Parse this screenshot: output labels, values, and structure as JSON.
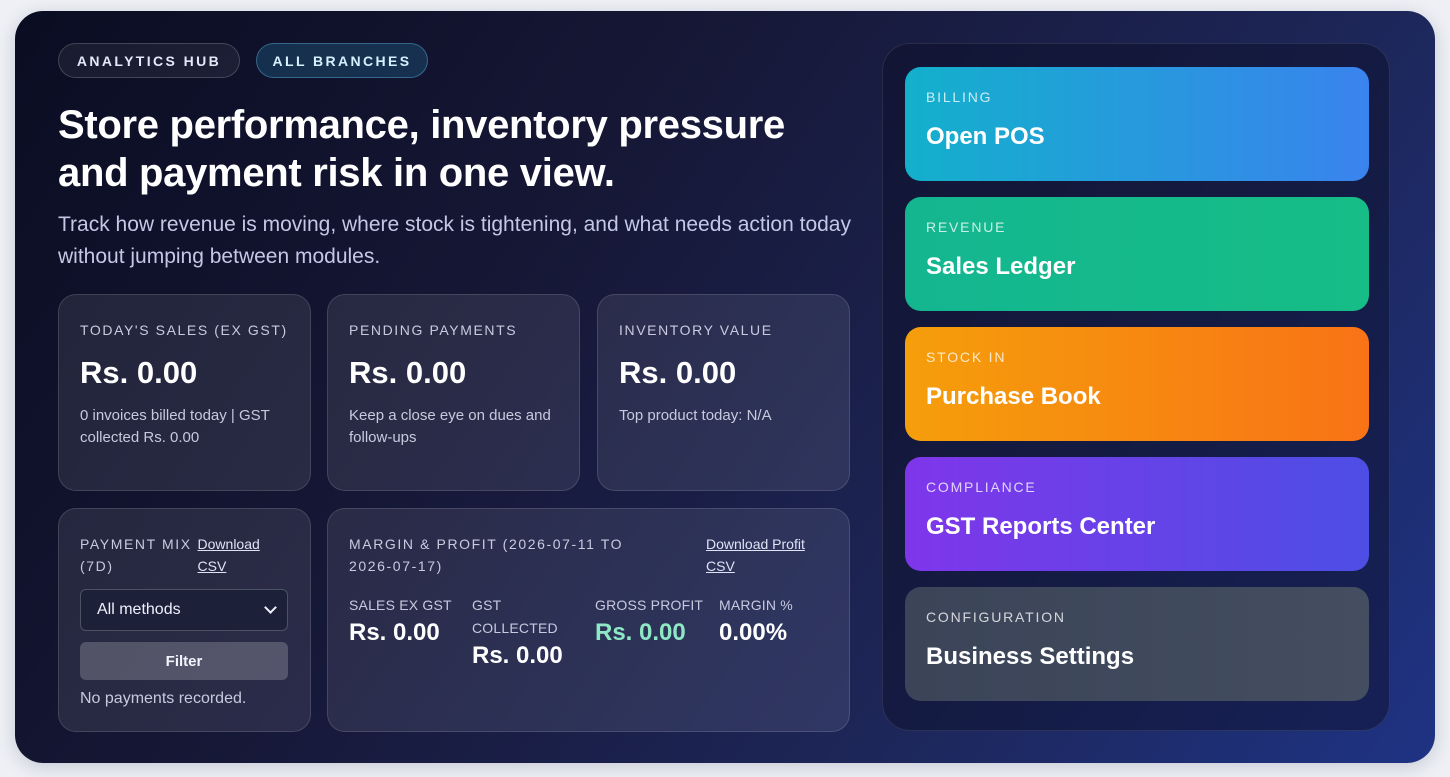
{
  "header": {
    "badges": [
      "ANALYTICS HUB",
      "ALL BRANCHES"
    ],
    "title": "Store performance, inventory pressure and payment risk in one view.",
    "subtitle": "Track how revenue is moving, where stock is tightening, and what needs action today without jumping between modules."
  },
  "kpis": [
    {
      "label": "TODAY'S SALES (EX GST)",
      "value": "Rs. 0.00",
      "note": "0 invoices billed today | GST collected Rs. 0.00"
    },
    {
      "label": "PENDING PAYMENTS",
      "value": "Rs. 0.00",
      "note": "Keep a close eye on dues and follow-ups"
    },
    {
      "label": "INVENTORY VALUE",
      "value": "Rs. 0.00",
      "note": "Top product today: N/A"
    }
  ],
  "payment_mix": {
    "label": "PAYMENT MIX (7D)",
    "download_label": "Download CSV",
    "select_value": "All methods",
    "filter_label": "Filter",
    "empty_text": "No payments recorded."
  },
  "margin": {
    "label": "MARGIN & PROFIT (2026-07-11 TO 2026-07-17)",
    "download_label": "Download Profit CSV",
    "stats": [
      {
        "label": "SALES EX GST",
        "value": "Rs. 0.00"
      },
      {
        "label": "GST COLLECTED",
        "value": "Rs. 0.00"
      },
      {
        "label": "GROSS PROFIT",
        "value": "Rs. 0.00"
      },
      {
        "label": "MARGIN %",
        "value": "0.00%"
      }
    ]
  },
  "quick_links": [
    {
      "kicker": "BILLING",
      "title": "Open POS"
    },
    {
      "kicker": "REVENUE",
      "title": "Sales Ledger"
    },
    {
      "kicker": "STOCK IN",
      "title": "Purchase Book"
    },
    {
      "kicker": "COMPLIANCE",
      "title": "GST Reports Center"
    },
    {
      "kicker": "CONFIGURATION",
      "title": "Business Settings"
    }
  ],
  "colors": {
    "profit_green": "#8ee8c4",
    "billing": "#3a83ee",
    "revenue": "#14b690",
    "stock_in": "#f97316",
    "compliance": "#7f36ea",
    "configuration": "#444e60"
  }
}
